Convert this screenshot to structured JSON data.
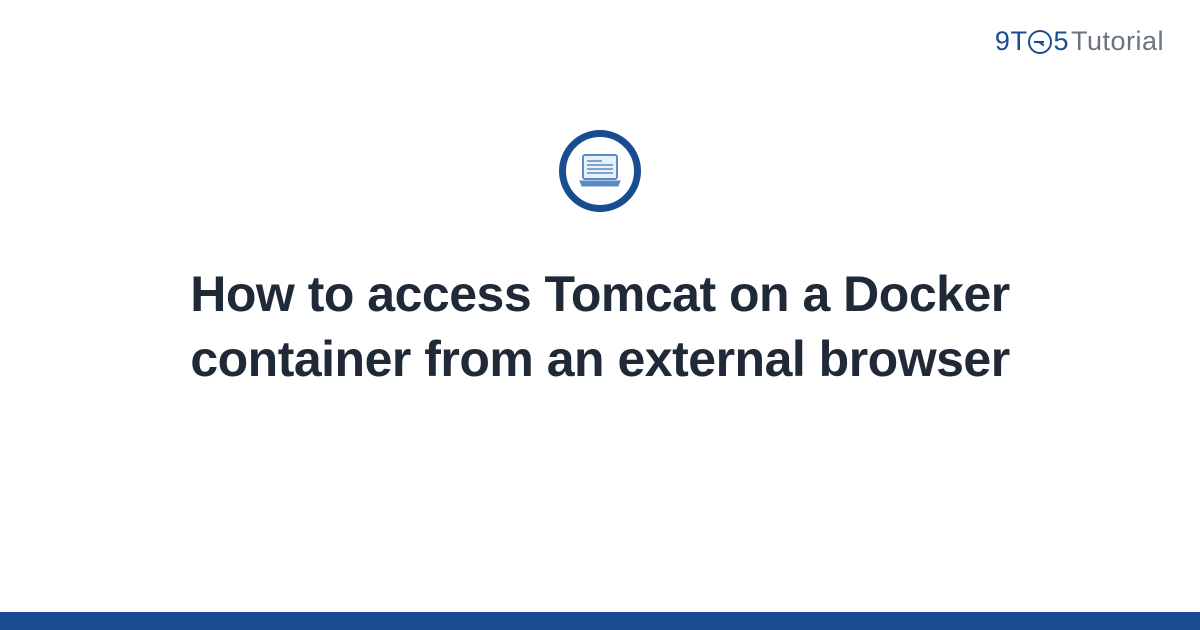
{
  "brand": {
    "part1": "9T",
    "part2": "5",
    "part3": "Tutorial"
  },
  "article": {
    "title": "How to access Tomcat on a Docker container from an external browser"
  },
  "colors": {
    "brand_blue": "#1a4d8f",
    "text_dark": "#1f2937",
    "text_gray": "#6b7280"
  }
}
